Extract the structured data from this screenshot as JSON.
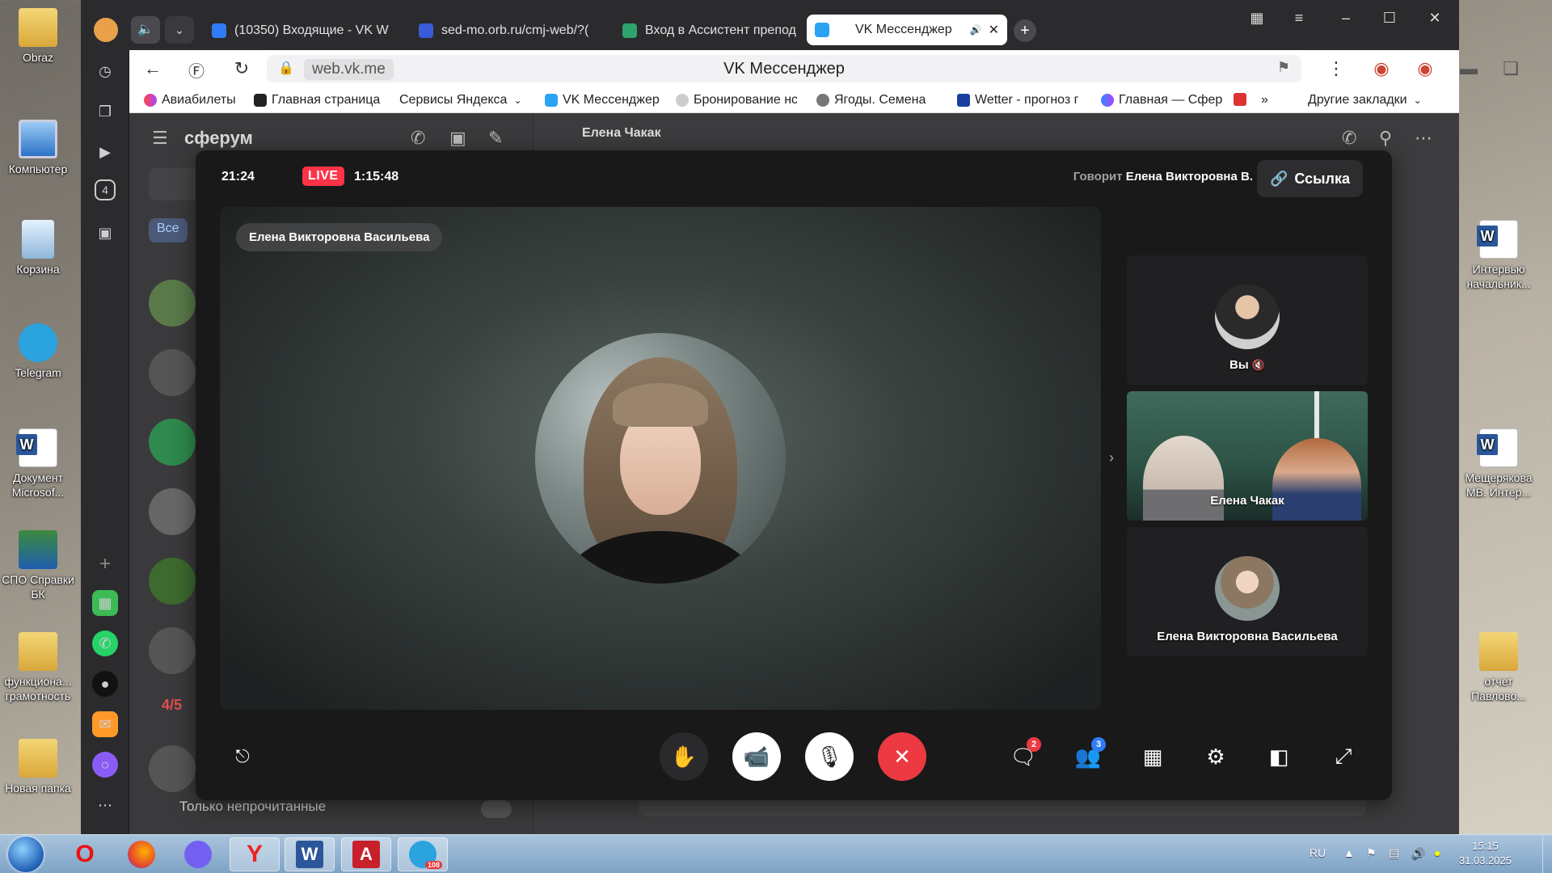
{
  "desktop": {
    "left_icons": [
      "Obraz",
      "Компьютер",
      "Корзина",
      "Telegram",
      "Документ Microsof...",
      "СПО Справки БК",
      "функциона... грамотность",
      "Новая папка"
    ],
    "right_icons": [
      "Интервью начальник...",
      "Мещерякова МВ. Интер...",
      "отчет Павлово..."
    ]
  },
  "browser": {
    "tabs": [
      {
        "title": "(10350) Входящие - VK W",
        "icon": "mail-icon",
        "color": "#2f7cf6"
      },
      {
        "title": "sed-mo.orb.ru/cmj-web/?(",
        "icon": "doc-icon",
        "color": "#3a5bd8"
      },
      {
        "title": "Вход в Ассистент препод",
        "icon": "v-icon",
        "color": "#2ea36b"
      },
      {
        "title": "VK Мессенджер",
        "icon": "vk-icon",
        "color": "#2aa3f5",
        "active": true
      }
    ],
    "dock_number": "4",
    "url_domain": "web.vk.me",
    "page_title": "VK Мессенджер",
    "bookmarks": [
      "Авиабилеты",
      "Главная страница",
      "Сервисы Яндекса",
      "VK Мессенджер",
      "Бронирование нс",
      "Ягоды. Семена ов",
      "Wetter - прогноз г",
      "Главная — Сфер"
    ],
    "bookmarks_more": "»",
    "other_bookmarks": "Другие закладки",
    "download_badge": "2"
  },
  "vk": {
    "brand": "сферум",
    "contact_name": "Елена Чакак",
    "filter_all": "Все",
    "counter": "4/5",
    "only_unread": "Только непрочитанные"
  },
  "call": {
    "clock": "21:24",
    "live_label": "LIVE",
    "duration": "1:15:48",
    "speaking_prefix": "Говорит",
    "speaking_name": "Елена Викторовна В.",
    "link_label": "Ссылка",
    "main_name": "Елена Викторовна Васильева",
    "tiles": [
      {
        "label": "Вы",
        "muted": true
      },
      {
        "label": "Елена Чакак"
      },
      {
        "label": "Елена Викторовна Васильева"
      }
    ],
    "chat_badge": "2",
    "participants_badge": "3"
  },
  "taskbar": {
    "lang": "RU",
    "time": "15:15",
    "date": "31.03.2025",
    "telegram_badge": "108"
  }
}
